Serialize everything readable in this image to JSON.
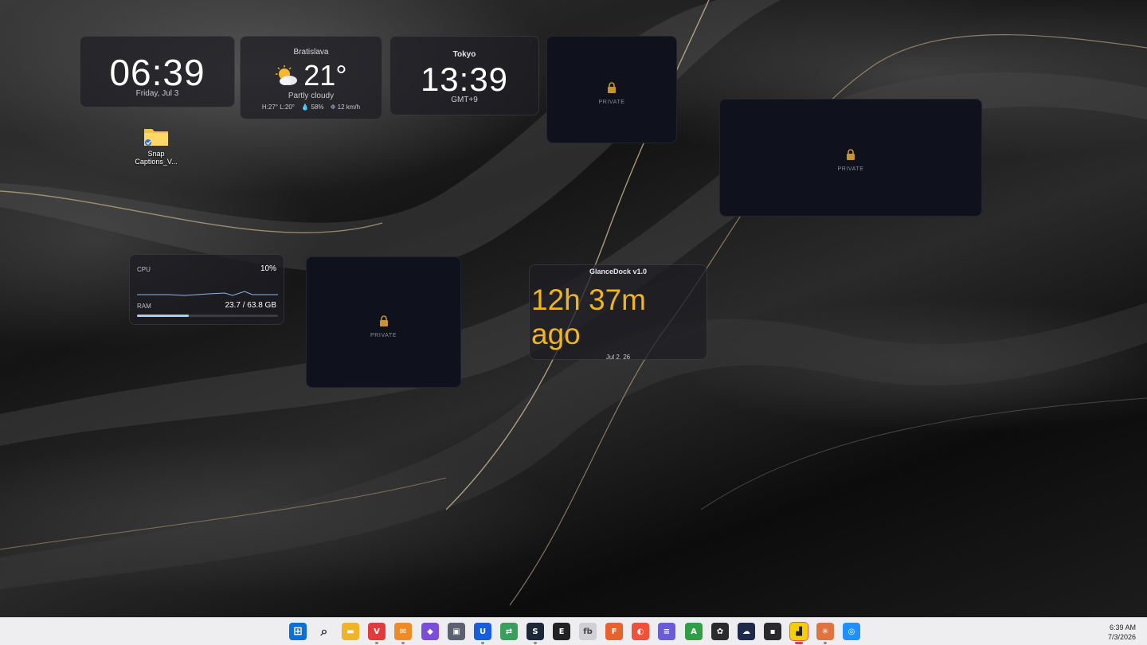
{
  "widgets": {
    "local_clock": {
      "time": "06:39",
      "date": "Friday, Jul 3"
    },
    "weather": {
      "city": "Bratislava",
      "temperature": "21°",
      "condition": "Partly cloudy",
      "high_low": "H:27° L:20°",
      "humidity": "58%",
      "wind": "12 km/h"
    },
    "world_clock": {
      "city": "Tokyo",
      "time": "13:39",
      "offset": "GMT+9"
    },
    "private_label": "PRIVATE",
    "system": {
      "cpu_label": "CPU",
      "cpu_value": "10%",
      "ram_label": "RAM",
      "ram_value": "23.7 / 63.8 GB",
      "ram_used_fraction": 0.37
    },
    "glancedock": {
      "title": "GlanceDock v1.0",
      "elapsed": "12h 37m ago",
      "date": "Jul 2, 26"
    }
  },
  "desktop_icons": [
    {
      "label_line1": "Snap",
      "label_line2": "Captions_V..."
    }
  ],
  "taskbar": {
    "time": "6:39 AM",
    "date": "7/3/2026",
    "apps": [
      {
        "name": "Start",
        "color": "#0a6fd8",
        "glyph": "⊞"
      },
      {
        "name": "Search",
        "color": "#eeeef0",
        "glyph": "⌕"
      },
      {
        "name": "File Explorer",
        "color": "#f0b429",
        "glyph": "▬"
      },
      {
        "name": "Vivaldi",
        "color": "#e23b3b",
        "glyph": "V"
      },
      {
        "name": "Mail",
        "color": "#f08a24",
        "glyph": "✉"
      },
      {
        "name": "Obsidian",
        "color": "#7c4ddb",
        "glyph": "◆"
      },
      {
        "name": "Window Tool",
        "color": "#5b6170",
        "glyph": "▣"
      },
      {
        "name": "Bitwarden",
        "color": "#175ddc",
        "glyph": "U"
      },
      {
        "name": "Translator",
        "color": "#3a9e5c",
        "glyph": "⇄"
      },
      {
        "name": "Steam",
        "color": "#1b2838",
        "glyph": "S"
      },
      {
        "name": "Epic Games",
        "color": "#222222",
        "glyph": "E"
      },
      {
        "name": "FileBot",
        "color": "#cfcfd4",
        "glyph": "fb"
      },
      {
        "name": "Fences",
        "color": "#e8622c",
        "glyph": "F"
      },
      {
        "name": "Swift",
        "color": "#f05138",
        "glyph": "◐"
      },
      {
        "name": "Notes",
        "color": "#6b5bd6",
        "glyph": "≡"
      },
      {
        "name": "Affinity",
        "color": "#2f9e44",
        "glyph": "A"
      },
      {
        "name": "ChatGPT",
        "color": "#2b2b2b",
        "glyph": "✿"
      },
      {
        "name": "Cloud App",
        "color": "#1f2a4a",
        "glyph": "☁"
      },
      {
        "name": "Terminal",
        "color": "#2a2a2e",
        "glyph": "▪"
      },
      {
        "name": "Sticky Notes",
        "color": "#f5d000",
        "glyph": "▟"
      },
      {
        "name": "Claude",
        "color": "#e1733f",
        "glyph": "✳"
      },
      {
        "name": "Sync",
        "color": "#1e90ff",
        "glyph": "◎"
      }
    ]
  }
}
